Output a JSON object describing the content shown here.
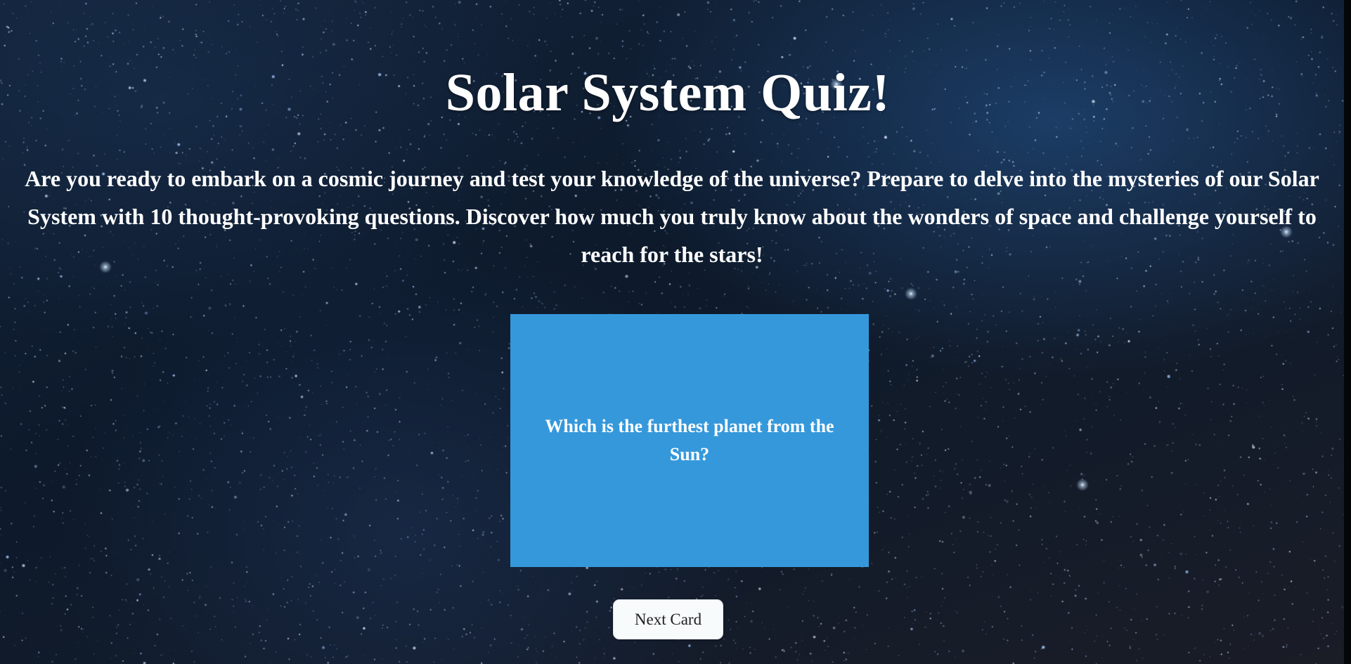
{
  "page": {
    "title": "Solar System Quiz!",
    "intro": "Are you ready to embark on a cosmic journey and test your knowledge of the universe? Prepare to delve into the mysteries of our Solar System with 10 thought-provoking questions. Discover how much you truly know about the wonders of space and challenge yourself to reach for the stars!"
  },
  "flashcard": {
    "question": "Which is the furthest planet from the Sun?"
  },
  "controls": {
    "next_label": "Next Card"
  },
  "colors": {
    "card_background": "#3598db",
    "text": "#ffffff",
    "button_background": "#f8fbfc",
    "button_text": "#202020",
    "background": "#0b1626"
  }
}
